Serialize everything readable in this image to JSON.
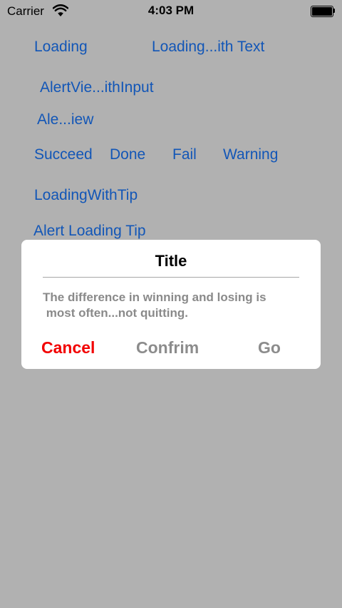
{
  "status_bar": {
    "carrier": "Carrier",
    "time": "4:03 PM",
    "wifi_icon": "wifi-icon",
    "battery_icon": "battery-icon"
  },
  "buttons": {
    "loading": "Loading",
    "loading_with_text": "Loading...ith Text",
    "alert_view_with_input": "AlertVie...ithInput",
    "alert_view": "Ale...iew",
    "succeed": "Succeed",
    "done": "Done",
    "fail": "Fail",
    "warning": "Warning",
    "loading_with_tip": "LoadingWithTip",
    "alert_loading_tip": "Alert Loading Tip"
  },
  "alert": {
    "title": "Title",
    "message": "The difference in winning and losing is\n most often...not quitting.",
    "actions": {
      "cancel": "Cancel",
      "confirm": "Confrim",
      "go": "Go"
    }
  },
  "colors": {
    "background": "#b1b1b1",
    "link": "#1256b7",
    "cancel": "#f20000",
    "secondary_action": "#8c8c8c",
    "message": "#8a8a8a"
  }
}
